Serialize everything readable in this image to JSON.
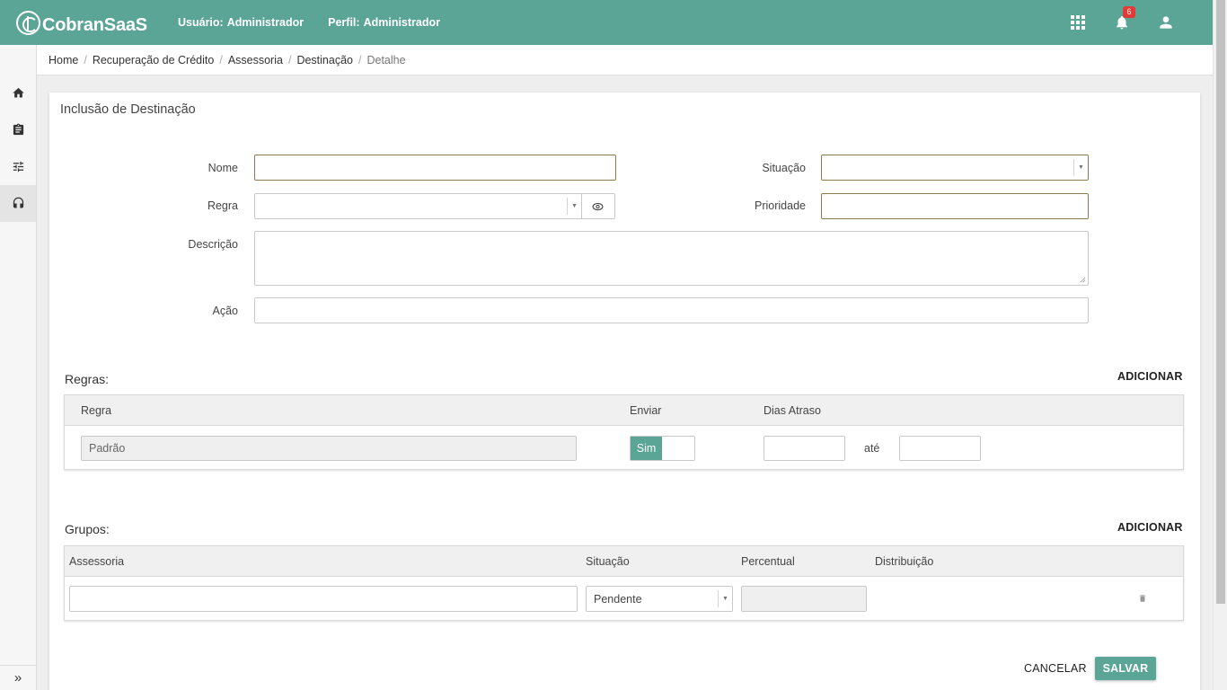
{
  "app": {
    "brand": "CobranSaaS",
    "user_label": "Usuário:",
    "user_value": "Administrador",
    "profile_label": "Perfil:",
    "profile_value": "Administrador",
    "notifications_count": "6",
    "accent_color": "#5ba597"
  },
  "sidebar": {
    "items": [
      {
        "icon": "home-icon"
      },
      {
        "icon": "clipboard-icon"
      },
      {
        "icon": "sliders-icon"
      },
      {
        "icon": "headset-icon",
        "active": true
      }
    ],
    "expand_label": "»"
  },
  "breadcrumb": {
    "items": [
      "Home",
      "Recuperação de Crédito",
      "Assessoria",
      "Destinação"
    ],
    "current": "Detalhe",
    "separator": "/"
  },
  "form": {
    "title": "Inclusão de Destinação",
    "nome_label": "Nome",
    "nome_value": "",
    "situacao_label": "Situação",
    "situacao_value": "",
    "regra_label": "Regra",
    "regra_value": "",
    "prioridade_label": "Prioridade",
    "prioridade_value": "",
    "descricao_label": "Descrição",
    "descricao_value": "",
    "acao_label": "Ação",
    "acao_value": ""
  },
  "regras": {
    "title": "Regras:",
    "add_label": "ADICIONAR",
    "columns": [
      "Regra",
      "Enviar",
      "Dias Atraso"
    ],
    "rows": [
      {
        "regra": "Padrão",
        "enviar": "Sim",
        "dias_de": "",
        "ate_label": "até",
        "dias_ate": ""
      }
    ]
  },
  "grupos": {
    "title": "Grupos:",
    "add_label": "ADICIONAR",
    "columns": [
      "Assessoria",
      "Situação",
      "Percentual",
      "Distribuição"
    ],
    "rows": [
      {
        "assessoria": "",
        "situacao": "Pendente",
        "percentual": "",
        "distribuicao": ""
      }
    ]
  },
  "actions": {
    "cancel_label": "CANCELAR",
    "save_label": "SALVAR"
  }
}
